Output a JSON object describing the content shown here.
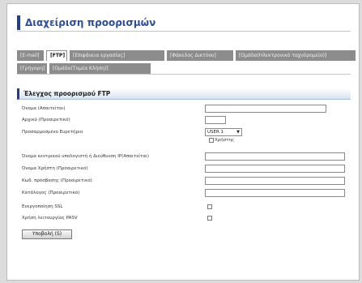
{
  "page": {
    "title": "Διαχείριση προορισμών"
  },
  "tabs": [
    {
      "label": "[E-mail]",
      "active": false
    },
    {
      "label": "[FTP]",
      "active": true
    },
    {
      "label": "[Επιφάνεια εργασίας]",
      "active": false
    },
    {
      "label": "[Φάκελος Δικτύου]",
      "active": false
    },
    {
      "label": "[Ομάδα(Ηλεκτρονικό ταχυδρομείο)]",
      "active": false
    },
    {
      "label": "[Γρήγορη]",
      "active": false
    },
    {
      "label": "[Ομάδα(Τομέα Κλήση)]",
      "active": false
    }
  ],
  "section": {
    "title": "Έλεγχος προορισμού FTP"
  },
  "fields": {
    "name": {
      "label": "Όνομα (Απαιτείται)",
      "value": ""
    },
    "initial": {
      "label": "Αρχικό (Προαιρετικό)",
      "value": ""
    },
    "index": {
      "label": "Προσαρμοσμένο Ευρετήριο",
      "value": "USER 1",
      "checkbox_label": "Χρήστης"
    },
    "host": {
      "label": "Όνομα κεντρικού υπολογιστή ή Διεύθυνση IP(Απαιτείται)",
      "value": ""
    },
    "username": {
      "label": "Όνομα Χρήστη (Προαιρετικό)",
      "value": ""
    },
    "password": {
      "label": "Κωδ. πρόσβασης (Προαιρετικό)",
      "value": ""
    },
    "directory": {
      "label": "Κατάλογος (Προαιρετικό)",
      "value": ""
    },
    "ssl": {
      "label": "Ενεργοποίηση SSL"
    },
    "pasv": {
      "label": "Χρήση λειτουργίας PASV"
    }
  },
  "submit": {
    "label": "Υποβολή (S)"
  },
  "colors": {
    "accent": "#2b4f9e",
    "tab_bg": "#8c8c8c"
  }
}
